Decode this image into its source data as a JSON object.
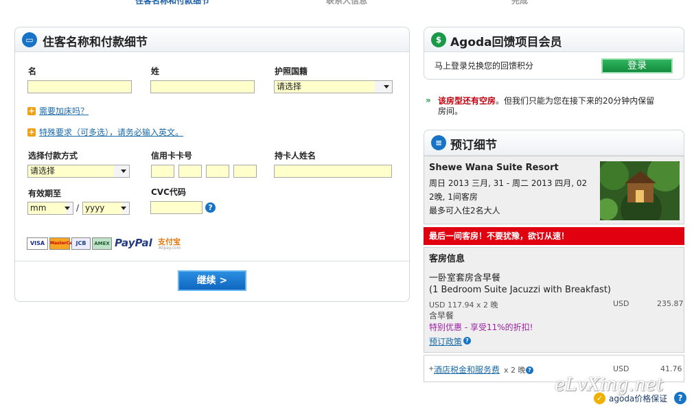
{
  "steps": [
    "住客名称和付款细节",
    "联系人信息",
    "完成"
  ],
  "guest_panel": {
    "title": "住客名称和付款细节",
    "first_name_label": "名",
    "last_name_label": "姓",
    "nationality_label": "护照国籍",
    "nationality_value": "请选择",
    "extra_bed_link": "需要加床吗？",
    "special_request_link": "特殊要求（可多选），请务必输入英文。",
    "payment_method_label": "选择付款方式",
    "payment_method_value": "请选择",
    "card_number_label": "信用卡卡号",
    "cardholder_label": "持卡人姓名",
    "expiry_label": "有效期至",
    "expiry_month": "mm",
    "expiry_year": "yyyy",
    "expiry_sep": "/",
    "cvc_label": "CVC代码",
    "card_logos": [
      "VISA",
      "MasterCard",
      "JCB",
      "AMEX"
    ],
    "paypal": "PayPal",
    "alipay": "支付宝",
    "alipay_sub": "Alipay.com",
    "continue_button": "继续 >"
  },
  "rewards": {
    "title": "Agoda回馈项目会员",
    "text": "马上登录兑换您的回馈积分",
    "login_button": "登录"
  },
  "notice": {
    "highlight": "该房型还有空房",
    "text_line1": "。但我们只能为您在接下来的20分钟内保留",
    "text_line2": "房间。"
  },
  "booking": {
    "title": "预订细节",
    "hotel_name": "Shewe Wana Suite Resort",
    "dates": "周日  2013 三月, 31 - 周二  2013 四月, 02",
    "nights_rooms": "2晚, 1间客房",
    "occupancy": "最多可入住2名大人",
    "urgent_banner": "最后一间客房！不要犹豫，欲订从速！",
    "room_info_title": "客房信息",
    "room_name_cn": "一卧室套房含早餐",
    "room_name_en": "(1 Bedroom Suite Jacuzzi with Breakfast)",
    "rate_line": "USD 117.94 x 2 晚",
    "rate_currency": "USD",
    "rate_total": "235.87",
    "breakfast": "含早餐",
    "promo": "特别优惠  - 享受11%的折扣!",
    "policy_link": "预订政策",
    "tax_prefix": "+",
    "tax_link": "酒店税金和服务费",
    "tax_nights": "x 2 晚",
    "tax_currency": "USD",
    "tax_total": "41.76"
  },
  "footer": {
    "guarantee": "agoda价格保证",
    "watermark": "eLvXing.net"
  },
  "colors": {
    "accent_blue": "#1773c6",
    "green": "#1a9a48",
    "red_banner": "#e0000f",
    "promo_purple": "#9b1fa3",
    "link_blue": "#1a6aa8"
  }
}
